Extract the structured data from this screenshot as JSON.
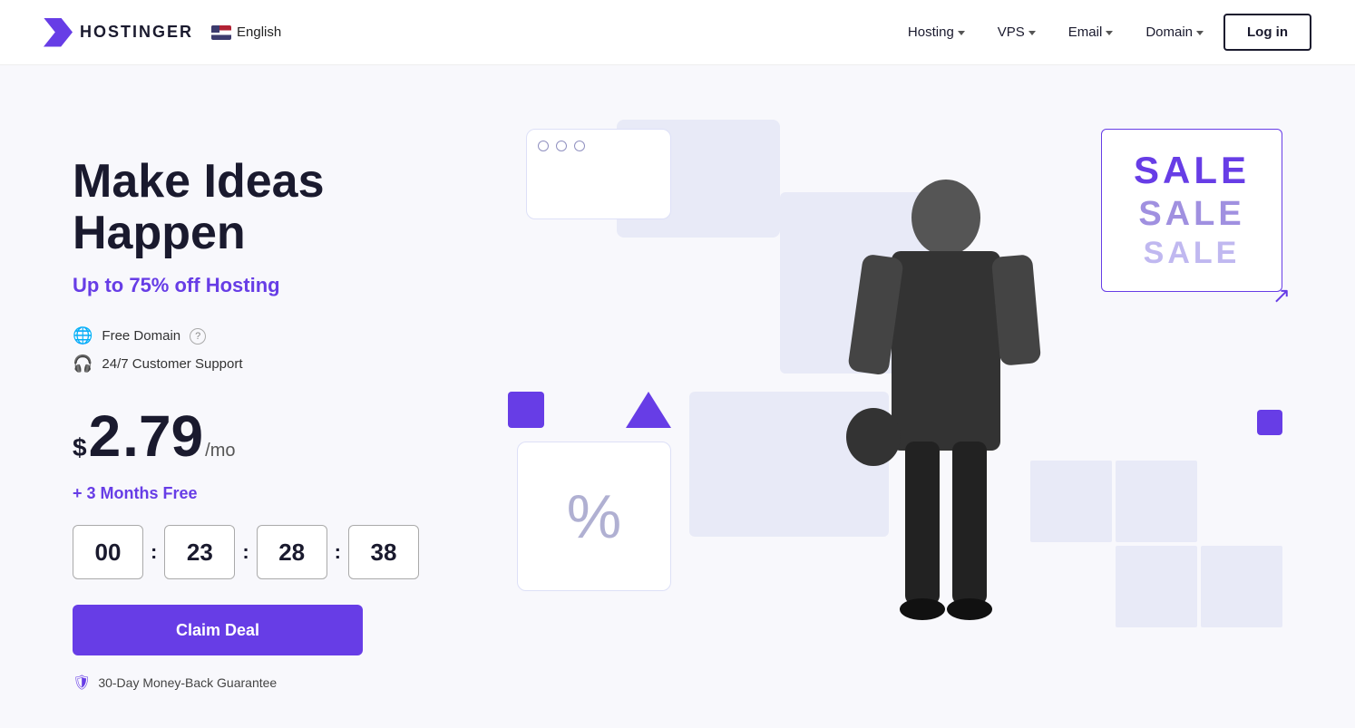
{
  "header": {
    "logo_text": "HOSTINGER",
    "lang": "English",
    "nav": [
      {
        "label": "Hosting",
        "has_dropdown": true
      },
      {
        "label": "VPS",
        "has_dropdown": true
      },
      {
        "label": "Email",
        "has_dropdown": true
      },
      {
        "label": "Domain",
        "has_dropdown": true
      }
    ],
    "login_label": "Log in"
  },
  "hero": {
    "title": "Make Ideas Happen",
    "subtitle_prefix": "Up to ",
    "subtitle_highlight": "75%",
    "subtitle_suffix": " off Hosting",
    "features": [
      {
        "text": "Free Domain",
        "has_info": true
      },
      {
        "text": "24/7 Customer Support",
        "has_info": false
      }
    ],
    "price_symbol": "$",
    "price_integer": "2",
    "price_decimal": ".79",
    "price_period": "/mo",
    "free_months": "+ 3 Months Free",
    "countdown": {
      "hours": "00",
      "minutes": "23",
      "seconds": "28",
      "frames": "38"
    },
    "claim_label": "Claim Deal",
    "guarantee": "30-Day Money-Back Guarantee"
  },
  "visual": {
    "sale_words": [
      "SALE",
      "SALE",
      "SALE"
    ],
    "browser_dots": 3,
    "percent_symbol": "%"
  },
  "colors": {
    "accent": "#673de6",
    "dark": "#1a1a2e",
    "light_bg": "#e8eaf7"
  }
}
